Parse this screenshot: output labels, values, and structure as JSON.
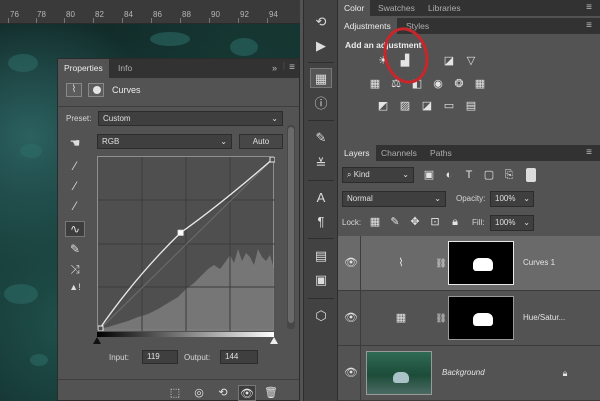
{
  "ruler": {
    "labels": [
      "76",
      "78",
      "80",
      "82",
      "84",
      "86",
      "88",
      "90",
      "92",
      "94"
    ]
  },
  "properties": {
    "tabs": [
      "Properties",
      "Info"
    ],
    "title": "Curves",
    "preset_label": "Preset:",
    "preset_value": "Custom",
    "channel_value": "RGB",
    "auto_label": "Auto",
    "input_label": "Input:",
    "input_value": "119",
    "output_label": "Output:",
    "output_value": "144",
    "curve": {
      "points": [
        [
          0,
          0
        ],
        [
          119,
          144
        ],
        [
          255,
          255
        ]
      ]
    }
  },
  "color_panel": {
    "tabs": [
      "Color",
      "Swatches",
      "Libraries"
    ]
  },
  "adjustments": {
    "tabs": [
      "Adjustments",
      "Styles"
    ],
    "heading": "Add an adjustment",
    "icons": [
      "brightness-icon",
      "levels-icon",
      "curves-icon",
      "exposure-icon",
      "vibrance-icon",
      "hue-saturation-icon",
      "color-balance-icon",
      "black-white-icon",
      "photo-filter-icon",
      "channel-mixer-icon",
      "color-lookup-icon",
      "invert-icon",
      "posterize-icon",
      "threshold-icon",
      "gradient-map-icon",
      "selective-color-icon"
    ]
  },
  "layers_panel": {
    "tabs": [
      "Layers",
      "Channels",
      "Paths"
    ],
    "kind_label": "Kind",
    "blend_mode": "Normal",
    "opacity_label": "Opacity:",
    "opacity_value": "100%",
    "lock_label": "Lock:",
    "fill_label": "Fill:",
    "fill_value": "100%",
    "layers": [
      {
        "name": "Curves 1",
        "selected": true
      },
      {
        "name": "Hue/Satur...",
        "selected": false
      },
      {
        "name": "Background",
        "selected": false
      }
    ]
  },
  "colors": {
    "accent_circle": "#c8262b",
    "panel_bg": "#535353",
    "dark_bg": "#323232"
  }
}
